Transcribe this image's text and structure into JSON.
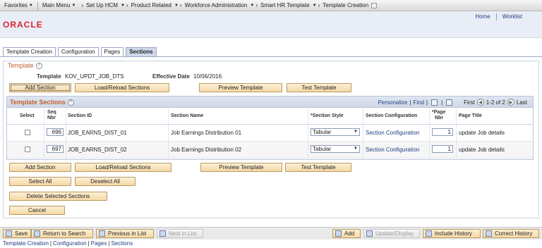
{
  "topnav": {
    "favorites": "Favorites",
    "main_menu": "Main Menu",
    "breadcrumbs": [
      "Set Up HCM",
      "Product Related",
      "Workforce Administration",
      "Smart HR Template",
      "Template Creation"
    ]
  },
  "header": {
    "logo": "ORACLE",
    "links": [
      "Home",
      "Worklist"
    ]
  },
  "tabs": [
    "Template Creation",
    "Configuration",
    "Pages",
    "Sections"
  ],
  "group": {
    "title": "Template",
    "template_label": "Template",
    "template_value": "KOV_UPDT_JOB_DTS",
    "effdate_label": "Effective Date",
    "effdate_value": "10/06/2016"
  },
  "buttons_top": {
    "add_section": "Add Section",
    "load_reload": "Load/Reload Sections",
    "preview": "Preview Template",
    "test": "Test Template"
  },
  "grid": {
    "title": "Template Sections",
    "personalize": "Personalize",
    "find": "Find",
    "first": "First",
    "range": "1-2 of 2",
    "last": "Last",
    "columns": {
      "select": "Select",
      "seq1": "Seq",
      "seq2": "Nbr",
      "section_id": "Section ID",
      "section_name": "Section Name",
      "section_style": "*Section Style",
      "section_config": "Section Configuration",
      "page1": "*Page",
      "page2": "Nbr",
      "page_title": "Page Title"
    },
    "rows": [
      {
        "seq": "696",
        "section_id": "JOB_EARNS_DIST_01",
        "section_name": "Job Earnings Distribution 01",
        "style": "Tabular",
        "config": "Section Configuration",
        "page": "1",
        "title": "update Job details"
      },
      {
        "seq": "697",
        "section_id": "JOB_EARNS_DIST_02",
        "section_name": "Job Earnings Distribution 02",
        "style": "Tabular",
        "config": "Section Configuration",
        "page": "1",
        "title": "update Job details"
      }
    ]
  },
  "buttons_bottom": {
    "add_section": "Add Section",
    "load_reload": "Load/Reload Sections",
    "preview": "Preview Template",
    "test": "Test Template",
    "select_all": "Select All",
    "deselect_all": "Deselect All",
    "delete_selected": "Delete Selected Sections",
    "cancel": "Cancel"
  },
  "toolbar": {
    "save": "Save",
    "return_to_search": "Return to Search",
    "previous_in_list": "Previous in List",
    "next_in_list": "Next in List",
    "add": "Add",
    "update_display": "Update/Display",
    "include_history": "Include History",
    "correct_history": "Correct History"
  },
  "footer_links": [
    "Template Creation",
    "Configuration",
    "Pages",
    "Sections"
  ],
  "colors": {
    "accent_orange": "#c2612c",
    "link_blue": "#1f3f80",
    "oracle_red": "#e0232b",
    "button_fill": "#f5d9a6"
  }
}
